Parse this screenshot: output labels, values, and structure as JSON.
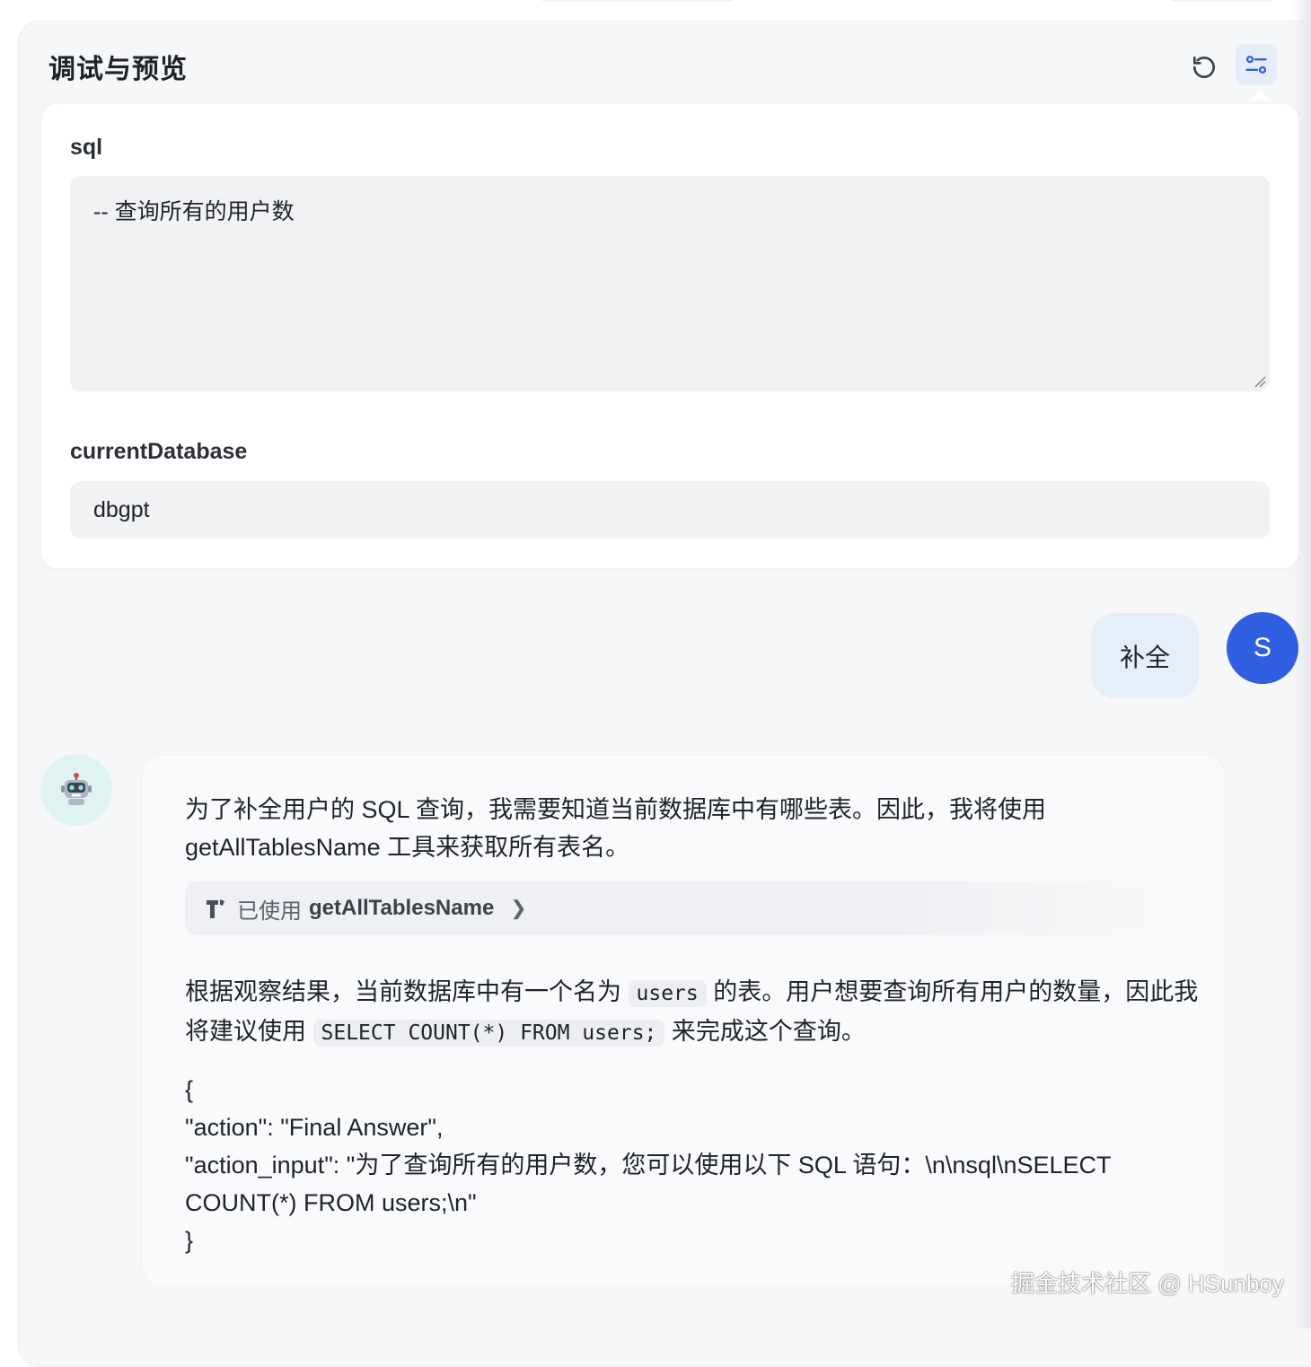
{
  "panel": {
    "title": "调试与预览",
    "refresh_icon": "refresh-icon",
    "settings_icon": "sliders-icon"
  },
  "form": {
    "sql_label": "sql",
    "sql_value": "-- 查询所有的用户数",
    "db_label": "currentDatabase",
    "db_value": "dbgpt"
  },
  "chat": {
    "user_message": "补全",
    "user_avatar_letter": "S",
    "bot_avatar": "robot-icon",
    "bot_intro": "为了补全用户的 SQL 查询，我需要知道当前数据库中有哪些表。因此，我将使用 getAllTablesName 工具来获取所有表名。",
    "tool_prefix": "已使用",
    "tool_name": "getAllTablesName",
    "observation_a": "根据观察结果，当前数据库中有一个名为 ",
    "observation_code1": "users",
    "observation_b": " 的表。用户想要查询所有用户的数量，因此我将建议使用 ",
    "observation_code2": "SELECT COUNT(*) FROM users;",
    "observation_c": " 来完成这个查询。",
    "json_lines": [
      "{",
      "\"action\": \"Final Answer\",",
      "\"action_input\": \"为了查询所有的用户数，您可以使用以下 SQL 语句：\\n\\nsql\\nSELECT COUNT(*) FROM users;\\n\"",
      "}"
    ]
  },
  "watermark": "掘金技术社区 @ HSunboy",
  "colors": {
    "accent": "#2f5fe0",
    "panel_bg": "#f6f7f9",
    "user_bubble": "#e6eef9",
    "bot_avatar_bg": "#dff3f2"
  }
}
